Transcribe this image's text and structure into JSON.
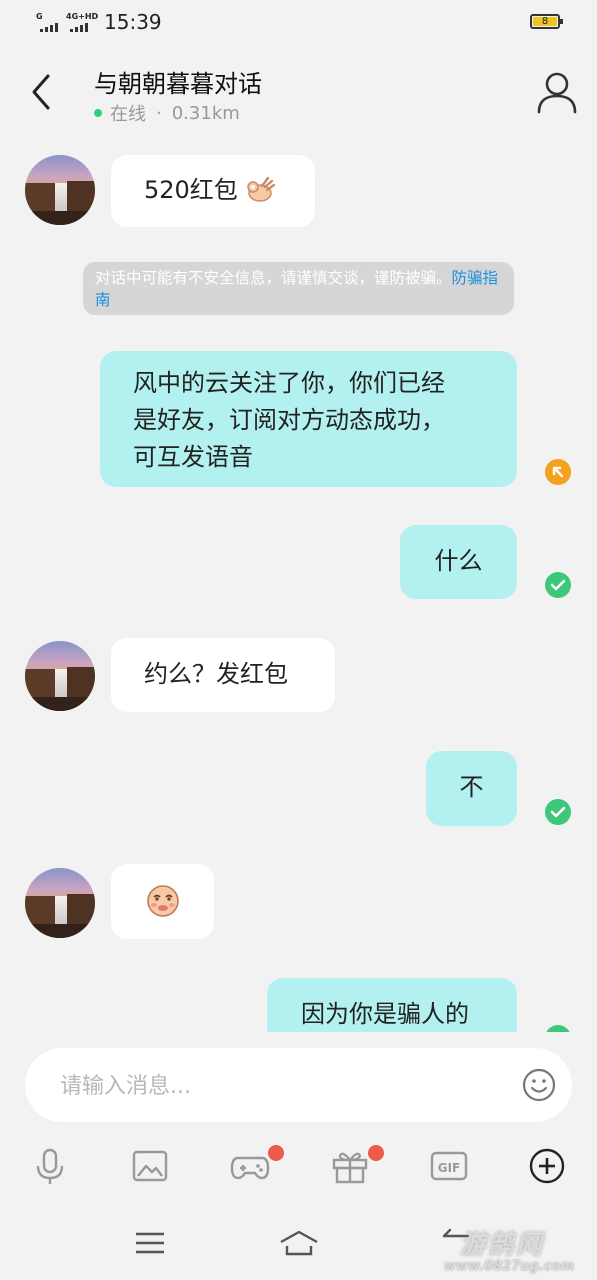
{
  "status_bar": {
    "signal1_label": "G",
    "signal2_label": "4G+HD",
    "time": "15:39",
    "battery_level": "8",
    "battery_color": "#f0c420"
  },
  "header": {
    "title": "与朝朝暮暮对话",
    "online_status": "在线",
    "separator": "·",
    "distance": "0.31km",
    "online_color": "#2bd47a",
    "back_icon": "chevron-left-icon",
    "profile_icon": "user-icon"
  },
  "messages": [
    {
      "from": "other",
      "text": "520红包",
      "emoji": "ok-hand-emoji"
    },
    {
      "from": "system",
      "text": "对话中可能有不安全信息，请谨慎交谈，谨防被骗。",
      "link_text": "防骗指南"
    },
    {
      "from": "me",
      "lines": [
        "风中的云关注了你，你们已经",
        "是好友，订阅对方动态成功，",
        "可互发语音"
      ],
      "status": "pending"
    },
    {
      "from": "me",
      "text": "什么",
      "status": "read"
    },
    {
      "from": "other",
      "text": "约么？发红包"
    },
    {
      "from": "me",
      "text": "不",
      "status": "read"
    },
    {
      "from": "other",
      "emoji": "smirk-face-emoji"
    },
    {
      "from": "me",
      "text": "因为你是骗人的",
      "status": "read"
    }
  ],
  "input": {
    "placeholder": "请输入消息...",
    "value": "",
    "emoji_icon": "smiley-icon"
  },
  "toolbar": {
    "items": [
      {
        "icon": "microphone-icon",
        "badge": false
      },
      {
        "icon": "image-icon",
        "badge": false
      },
      {
        "icon": "gamepad-icon",
        "badge": true
      },
      {
        "icon": "gift-icon",
        "badge": true
      },
      {
        "icon": "gif-icon",
        "label": "GIF",
        "badge": false
      },
      {
        "icon": "plus-circle-icon",
        "badge": false
      }
    ],
    "badge_color": "#f05a4a"
  },
  "nav_bar": {
    "items": [
      "menu-icon",
      "home-icon",
      "back-icon"
    ]
  },
  "watermark": {
    "text": "游鹄网",
    "url": "www.0827ug.com"
  },
  "colors": {
    "my_bubble": "#b2f1ef",
    "other_bubble": "#ffffff",
    "read_check": "#3cc77a",
    "pending": "#f4a11f",
    "link": "#1e8fe0"
  }
}
